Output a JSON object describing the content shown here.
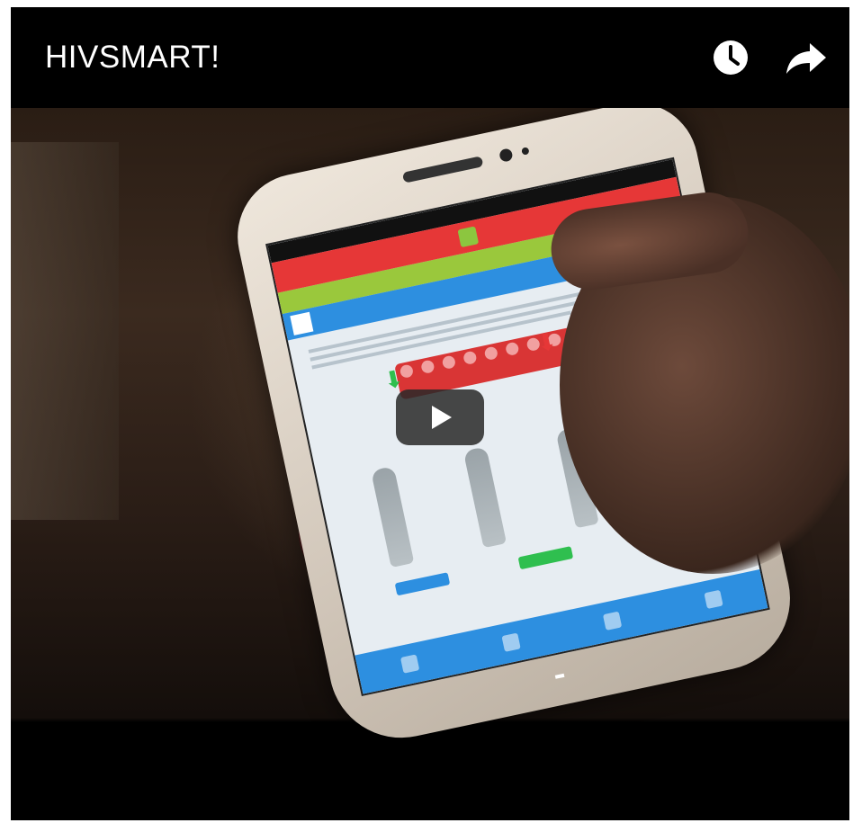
{
  "video": {
    "title": "HIVSMART!",
    "watch_later_icon": "clock-icon",
    "share_icon": "share-arrow-icon",
    "play_icon": "play-icon"
  }
}
